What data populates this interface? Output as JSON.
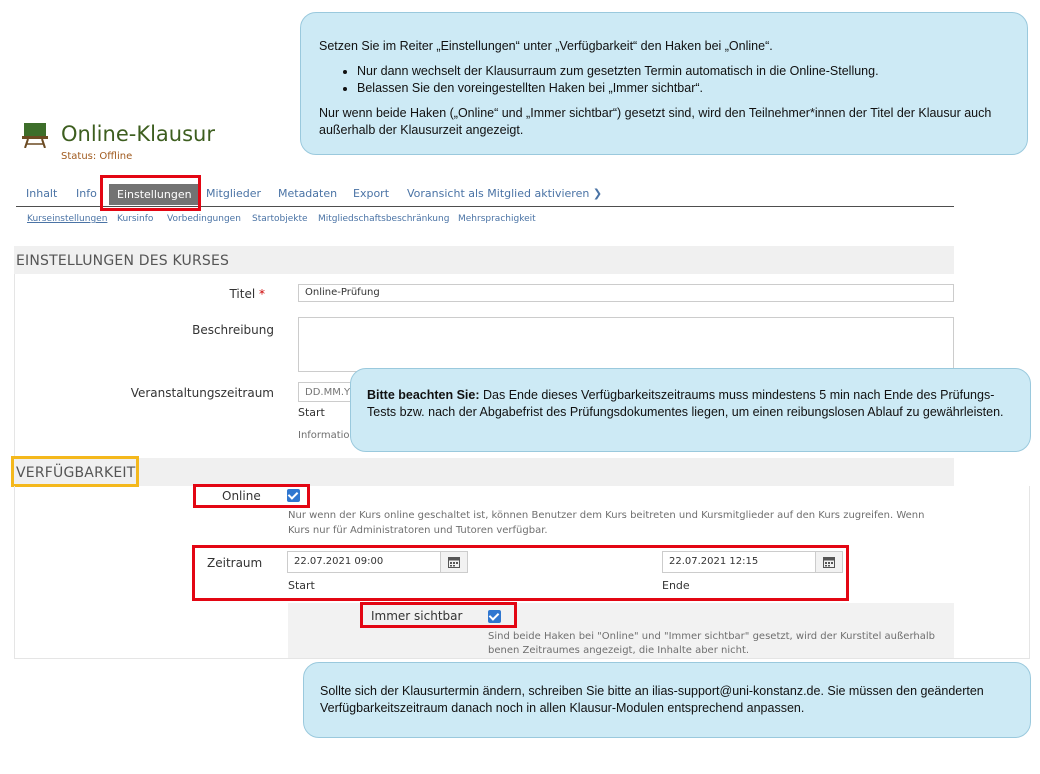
{
  "header": {
    "title": "Online-Klausur",
    "status": "Status: Offline"
  },
  "tabs": [
    {
      "label": "Inhalt"
    },
    {
      "label": "Info"
    },
    {
      "label": "Einstellungen"
    },
    {
      "label": "Mitglieder"
    },
    {
      "label": "Metadaten"
    },
    {
      "label": "Export"
    },
    {
      "label": "Voransicht als Mitglied aktivieren"
    }
  ],
  "subtabs": [
    {
      "label": "Kurseinstellungen"
    },
    {
      "label": "Kursinfo"
    },
    {
      "label": "Vorbedingungen"
    },
    {
      "label": "Startobjekte"
    },
    {
      "label": "Mitgliedschaftsbeschränkung"
    },
    {
      "label": "Mehrsprachigkeit"
    }
  ],
  "course_settings": {
    "section_title": "EINSTELLUNGEN DES KURSES",
    "title_label": "Titel",
    "required_mark": "*",
    "title_value": "Online-Prüfung",
    "description_label": "Beschreibung",
    "description_value": "",
    "period_label": "Veranstaltungszeitraum",
    "period_placeholder": "DD.MM.YY",
    "period_start_label": "Start",
    "period_info": "Information"
  },
  "availability": {
    "section_title": "VERFÜGBARKEIT",
    "online_label": "Online",
    "online_checked": true,
    "online_help_line1": "Nur wenn der Kurs online geschaltet ist, können Benutzer dem Kurs beitreten und Kursmitglieder auf den Kurs zugreifen. Wenn",
    "online_help_line2": "Kurs nur für Administratoren und Tutoren verfügbar.",
    "period_label": "Zeitraum",
    "start_value": "22.07.2021 09:00",
    "start_label": "Start",
    "end_value": "22.07.2021 12:15",
    "end_label": "Ende",
    "always_visible_label": "Immer sichtbar",
    "always_visible_checked": true,
    "visible_help_line1": "Sind beide Haken bei \"Online\" und \"Immer sichtbar\" gesetzt, wird der Kurstitel außerhalb",
    "visible_help_line2": "benen Zeitraumes angezeigt, die Inhalte aber nicht."
  },
  "callouts": {
    "top_intro": "Setzen Sie im Reiter „Einstellungen“ unter „Verfügbarkeit“ den Haken bei „Online“.",
    "top_bullet1": "Nur dann wechselt der Klausurraum zum gesetzten Termin automatisch in die   Online-Stellung.",
    "top_bullet2": "Belassen Sie den voreingestellten Haken bei „Immer sichtbar“.",
    "top_outro": "Nur wenn beide Haken („Online“ und „Immer sichtbar“) gesetzt sind, wird den Teilnehmer*innen der Titel der Klausur auch außerhalb der Klausurzeit angezeigt.",
    "middle_bold": "Bitte beachten Sie:",
    "middle_text": " Das Ende dieses Verfügbarkeitszeitraums muss mindestens 5 min nach Ende des Prüfungs-Tests bzw. nach der Abgabefrist des Prüfungsdokumentes liegen, um einen reibungslosen Ablauf zu gewährleisten.",
    "bottom_text": "Sollte sich der Klausurtermin ändern, schreiben Sie bitte an ilias-support@uni-konstanz.de. Sie müssen den geänderten Verfügbarkeitszeitraum danach noch in allen Klausur-Modulen entsprechend anpassen."
  },
  "colors": {
    "highlight_red": "#e30613",
    "highlight_yellow": "#f4b81c",
    "callout_bg": "#cdeaf5",
    "title_green": "#3d5e1f",
    "checkbox_blue": "#3077d0"
  },
  "icons": {
    "course_icon": "exam-board-icon",
    "tab_arrow": "chevron-right-icon",
    "calendar": "calendar-icon"
  }
}
